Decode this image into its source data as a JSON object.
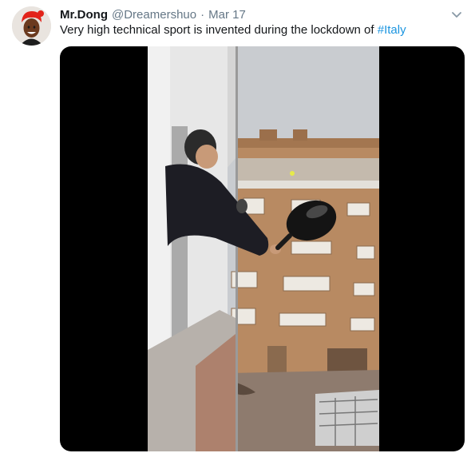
{
  "tweet": {
    "author_name": "Mr.Dong",
    "handle": "@Dreamershuo",
    "separator": "·",
    "timestamp": "Mar 17",
    "text": "Very high technical sport is invented during the lockdown of ",
    "hashtag": "#Italy",
    "icons": {
      "menu": "chevron-down-icon",
      "avatar": "avatar-image"
    }
  },
  "colors": {
    "link": "#1b95e0",
    "secondary_text": "#657786",
    "primary_text": "#14171a",
    "video_letterbox": "#000000"
  }
}
